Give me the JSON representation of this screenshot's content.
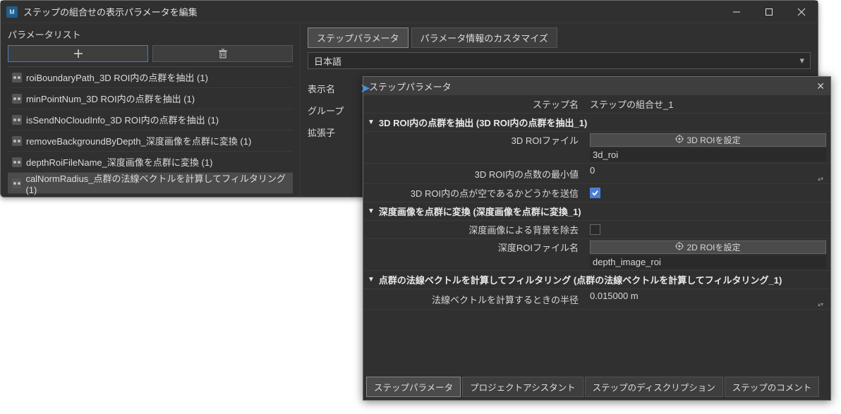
{
  "window1": {
    "title": "ステップの組合せの表示パラメータを編集",
    "leftPanel": {
      "label": "パラメータリスト",
      "addIcon": "＋",
      "deleteIcon": "🗑",
      "items": [
        "roiBoundaryPath_3D ROI内の点群を抽出  (1)",
        "minPointNum_3D ROI内の点群を抽出  (1)",
        "isSendNoCloudInfo_3D ROI内の点群を抽出  (1)",
        "removeBackgroundByDepth_深度画像を点群に変換  (1)",
        "depthRoiFileName_深度画像を点群に変換  (1)",
        "calNormRadius_点群の法線ベクトルを計算してフィルタリング  (1)"
      ],
      "selectedIndex": 5
    },
    "rightPanel": {
      "tabs": [
        "ステップパラメータ",
        "パラメータ情報のカスタマイズ"
      ],
      "activeTab": 0,
      "language": "日本語",
      "columns": [
        "表示名",
        "グループ",
        "拡張子"
      ]
    }
  },
  "window2": {
    "title": "ステップパラメータ",
    "stepNameLabel": "ステップ名",
    "stepNameValue": "ステップの組合せ_1",
    "groups": [
      {
        "header": "3D ROI内の点群を抽出  (3D ROI内の点群を抽出_1)",
        "rows": [
          {
            "type": "button",
            "label": "3D ROIファイル",
            "button": "3D ROIを設定",
            "value": "3d_roi",
            "icon": "target"
          },
          {
            "type": "number",
            "label": "3D ROI内の点数の最小値",
            "value": "0"
          },
          {
            "type": "checkbox",
            "label": "3D ROI内の点が空であるかどうかを送信",
            "checked": true
          }
        ]
      },
      {
        "header": "深度画像を点群に変換  (深度画像を点群に変換_1)",
        "rows": [
          {
            "type": "checkbox",
            "label": "深度画像による背景を除去",
            "checked": false
          },
          {
            "type": "button",
            "label": "深度ROIファイル名",
            "button": "2D ROIを設定",
            "value": "depth_image_roi",
            "icon": "target"
          }
        ]
      },
      {
        "header": "点群の法線ベクトルを計算してフィルタリング  (点群の法線ベクトルを計算してフィルタリング_1)",
        "rows": [
          {
            "type": "number",
            "label": "法線ベクトルを計算するときの半径",
            "value": "0.015000 m"
          }
        ]
      }
    ],
    "bottomTabs": [
      "ステップパラメータ",
      "プロジェクトアシスタント",
      "ステップのディスクリプション",
      "ステップのコメント"
    ],
    "activeBottomTab": 0
  }
}
